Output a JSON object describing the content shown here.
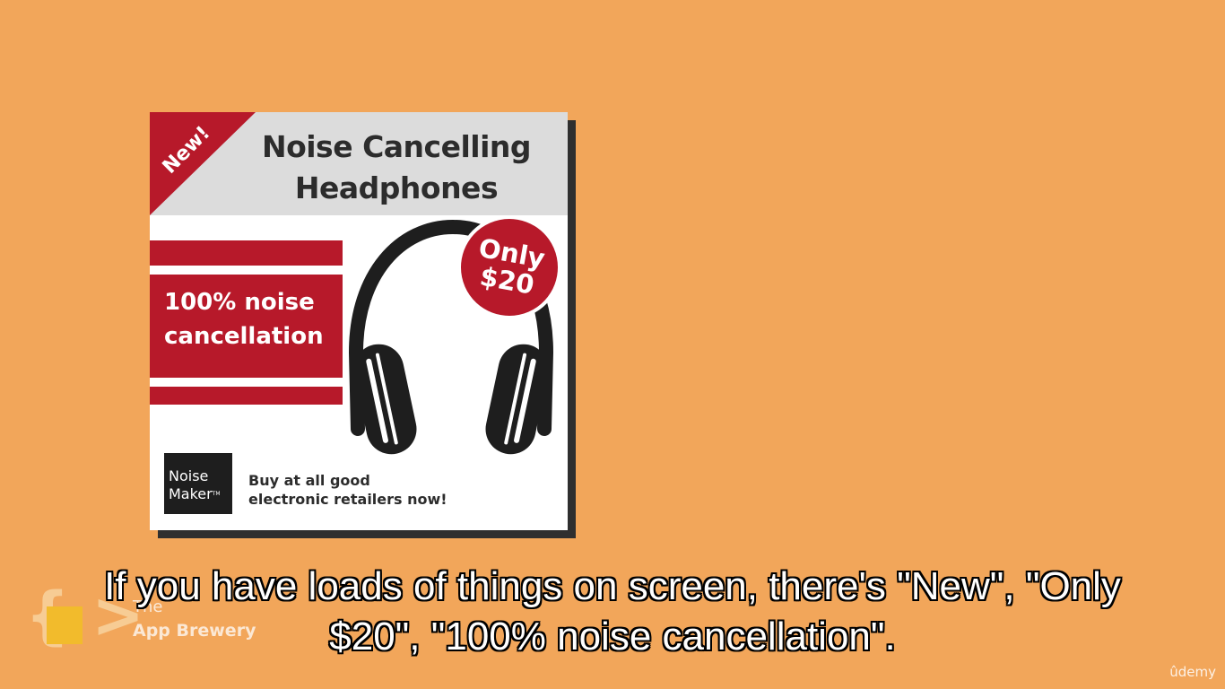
{
  "ad": {
    "corner_badge": "New!",
    "title_line_1": "Noise Cancelling",
    "title_line_2": "Headphones",
    "price_line_1": "Only",
    "price_line_2": "$20",
    "feature_line_1": "100% noise",
    "feature_line_2": "cancellation",
    "brand_line_1": "Noise",
    "brand_line_2": "Maker",
    "brand_trademark": "TM",
    "tagline_line_1": "Buy at all good",
    "tagline_line_2": "electronic retailers now!"
  },
  "watermark": {
    "prefix": "The",
    "name": "App Brewery"
  },
  "subtitle": {
    "line_1": "If you have loads of things on screen, there's \"New\", \"Only",
    "line_2": "$20\", \"100% noise cancellation\"."
  },
  "platform_mark": "ûdemy",
  "colors": {
    "background": "#f2a65a",
    "accent_red": "#b7192a",
    "header_gray": "#dcdcdc"
  }
}
